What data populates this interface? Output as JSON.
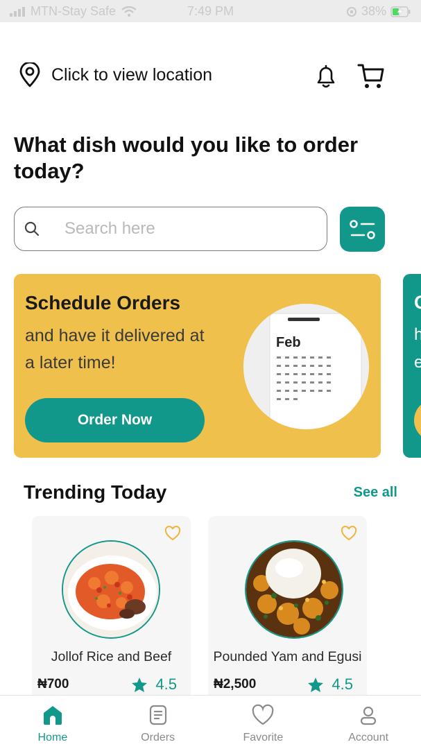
{
  "status_bar": {
    "carrier": "MTN-Stay Safe",
    "time": "7:49 PM",
    "battery": "38%"
  },
  "header": {
    "location_label": "Click to view location",
    "icons": [
      "location-pin-icon",
      "bell-icon",
      "cart-icon"
    ]
  },
  "headline": "What dish would you like to order today?",
  "search": {
    "placeholder": "Search here",
    "value": ""
  },
  "promo": {
    "title": "Schedule Orders",
    "subtitle": "and have it delivered at a later time!",
    "button_label": "Order Now",
    "image_label": "Feb",
    "next_card_letters": [
      "C",
      "h",
      "e"
    ]
  },
  "trending": {
    "title": "Trending Today",
    "see_all": "See all",
    "items": [
      {
        "name": "Jollof Rice and Beef",
        "price": "₦700",
        "rating": "4.5"
      },
      {
        "name": "Pounded Yam and Egusi",
        "price": "₦2,500",
        "rating": "4.5"
      }
    ]
  },
  "nav": {
    "items": [
      {
        "label": "Home",
        "icon": "home-icon",
        "active": true
      },
      {
        "label": "Orders",
        "icon": "orders-icon",
        "active": false
      },
      {
        "label": "Favorite",
        "icon": "heart-icon",
        "active": false
      },
      {
        "label": "Account",
        "icon": "account-icon",
        "active": false
      }
    ]
  },
  "colors": {
    "accent": "#12988a",
    "promo_bg": "#f0c04c",
    "heart": "#f0b43c"
  }
}
